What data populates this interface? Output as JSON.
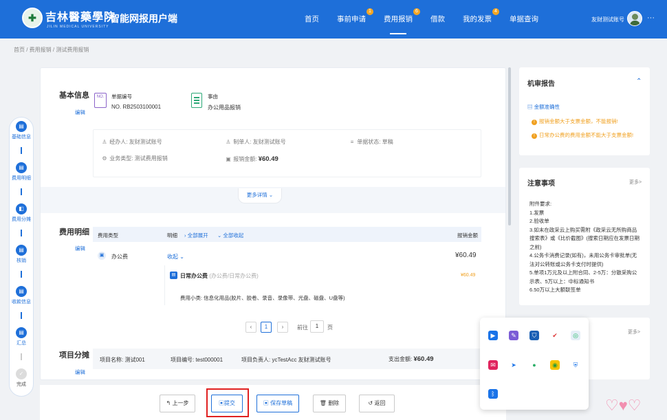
{
  "header": {
    "brand": "吉林醫藥學院",
    "brand_sub": "JILIN MEDICAL UNIVERSITY",
    "app_title": "智能网报用户端",
    "nav": [
      {
        "label": "首页",
        "badge": ""
      },
      {
        "label": "事前申请",
        "badge": "1"
      },
      {
        "label": "费用报销",
        "badge": "6"
      },
      {
        "label": "借款",
        "badge": ""
      },
      {
        "label": "我的发票",
        "badge": "4"
      },
      {
        "label": "单据查询",
        "badge": ""
      }
    ],
    "username": "友财测试账号",
    "more": "···"
  },
  "breadcrumb": "首页 / 费用报销 / 测试费用报销",
  "steps": [
    {
      "label": "基础信息",
      "icon": "document-icon",
      "glyph": "▤"
    },
    {
      "label": "费用明细",
      "icon": "list-icon",
      "glyph": "▤"
    },
    {
      "label": "费用分摊",
      "icon": "share-icon",
      "glyph": "◧"
    },
    {
      "label": "核销",
      "icon": "check-doc-icon",
      "glyph": "▤"
    },
    {
      "label": "收款信息",
      "icon": "payee-icon",
      "glyph": "▤"
    },
    {
      "label": "汇总",
      "icon": "summary-icon",
      "glyph": "▤"
    },
    {
      "label": "完成",
      "icon": "check-icon",
      "glyph": "✓"
    }
  ],
  "basic_info": {
    "title": "基本信息",
    "edit": "编辑",
    "doc_no_label": "单据编号",
    "doc_no": "NO. RB2503100001",
    "reason_label": "事由",
    "reason": "办公用品报销",
    "handler_label": "经办人:",
    "handler": "友财测试账号",
    "maker_label": "制单人:",
    "maker": "友财测试账号",
    "status_label": "单据状态:",
    "status": "草稿",
    "biz_type_label": "业务类型:",
    "biz_type": "测试费用报销",
    "amount_label": "报销金额:",
    "amount": "¥60.49",
    "more_details": "更多详情"
  },
  "expense": {
    "title": "费用明细",
    "edit": "编辑",
    "col_type": "费用类型",
    "col_detail": "明细",
    "expand_all": "全部展开",
    "collapse_all": "全部收起",
    "col_amount": "报销金额",
    "row_type": "办公费",
    "row_toggle": "收起",
    "row_amount": "¥60.49",
    "sub_name": "日常办公费",
    "sub_tag": "(办公费/日常办公费)",
    "sub_amount": "¥60.49",
    "sub_category": "费用小类: 信息化用品(胶片、胶卷、录音、录像带、光盘、磁盘、U盘等)",
    "page": "1",
    "goto_label": "前往",
    "goto_value": "1",
    "page_unit": "页"
  },
  "project": {
    "title": "项目分摊",
    "edit": "编辑",
    "name": "项目名称: 测试001",
    "code": "项目编号: test000001",
    "owner": "项目负责人: ycTestAcc 友财测试账号",
    "amount_label": "支出金额:",
    "amount": "¥60.49"
  },
  "review": {
    "title": "机审报告",
    "item_title": "金额准确性",
    "warnings": [
      "报销金额大于支票金额，不能报销!",
      "日常办公费的费用金额不能大于支票金额!"
    ]
  },
  "notice": {
    "title": "注意事项",
    "more": "更多>",
    "lines": [
      "附件要求:",
      "1.发票",
      "2.验收单",
      "3.如末在政采云上购买需附《政采云无所购商品搜索表》或《比价截图》(搜索日期应在发票日期之前)",
      "4.公务卡消费记录(如有)，未用公务卡审批单(无法对公转账或公务卡支付时提供)",
      "5.单项1万元及以上附合同、2-5万：分散采购公示表、5万以上：中标通知书",
      "6.50万以上大额联签单"
    ]
  },
  "third_card": {
    "more": "更多>"
  },
  "footer": {
    "prev": "上一步",
    "submit": "提交",
    "save": "保存草稿",
    "delete": "删除",
    "back": "返回"
  },
  "colors": {
    "primary": "#1e6fd9",
    "warning": "#f0a020",
    "highlight": "#e02020"
  }
}
